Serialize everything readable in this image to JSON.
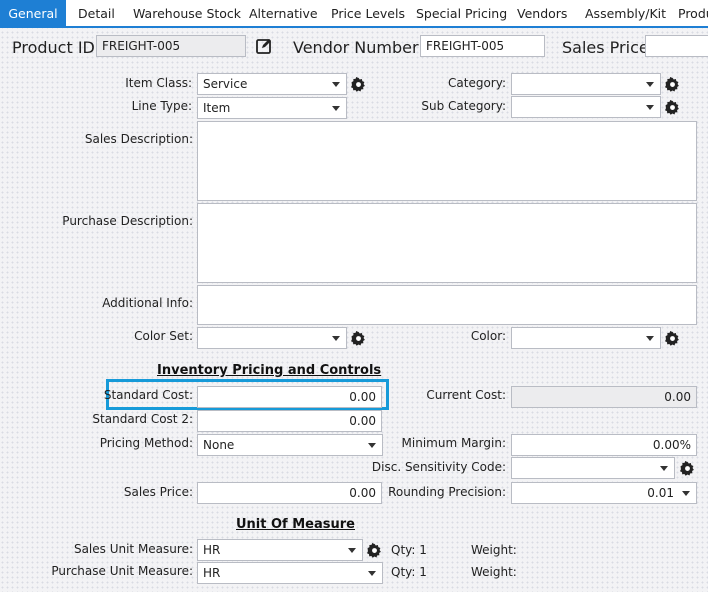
{
  "tabs": [
    "General",
    "Detail",
    "Warehouse Stock",
    "Alternative",
    "Price Levels",
    "Special Pricing",
    "Vendors",
    "Assembly/Kit",
    "Produ"
  ],
  "header": {
    "product_id_label": "Product ID:",
    "product_id_value": "FREIGHT-005",
    "vendor_number_label": "Vendor Number:",
    "vendor_number_value": "FREIGHT-005",
    "sales_price_label": "Sales Price:",
    "sales_price_value": ""
  },
  "fields": {
    "item_class_label": "Item Class:",
    "item_class_value": "Service",
    "line_type_label": "Line Type:",
    "line_type_value": "Item",
    "category_label": "Category:",
    "category_value": "",
    "sub_category_label": "Sub Category:",
    "sub_category_value": "",
    "sales_description_label": "Sales Description:",
    "purchase_description_label": "Purchase Description:",
    "additional_info_label": "Additional Info:",
    "color_set_label": "Color Set:",
    "color_set_value": "",
    "color_label": "Color:",
    "color_value": ""
  },
  "inventory": {
    "title": "Inventory Pricing and Controls",
    "standard_cost_label": "Standard Cost:",
    "standard_cost_value": "0.00",
    "current_cost_label": "Current Cost:",
    "current_cost_value": "0.00",
    "standard_cost2_label": "Standard Cost 2:",
    "standard_cost2_value": "0.00",
    "pricing_method_label": "Pricing Method:",
    "pricing_method_value": "None",
    "minimum_margin_label": "Minimum Margin:",
    "minimum_margin_value": "0.00%",
    "disc_sensitivity_label": "Disc. Sensitivity Code:",
    "disc_sensitivity_value": "",
    "sales_price_label": "Sales Price:",
    "sales_price_value": "0.00",
    "rounding_precision_label": "Rounding Precision:",
    "rounding_precision_value": "0.01"
  },
  "uom": {
    "title": "Unit Of Measure",
    "sales_unit_label": "Sales Unit Measure:",
    "sales_unit_value": "HR",
    "sales_qty": "Qty: 1",
    "sales_weight": "Weight:",
    "purchase_unit_label": "Purchase Unit Measure:",
    "purchase_unit_value": "HR",
    "purchase_qty": "Qty: 1",
    "purchase_weight": "Weight:"
  },
  "colors": {
    "accent": "#1e7fd4",
    "highlight": "#169ad8"
  }
}
